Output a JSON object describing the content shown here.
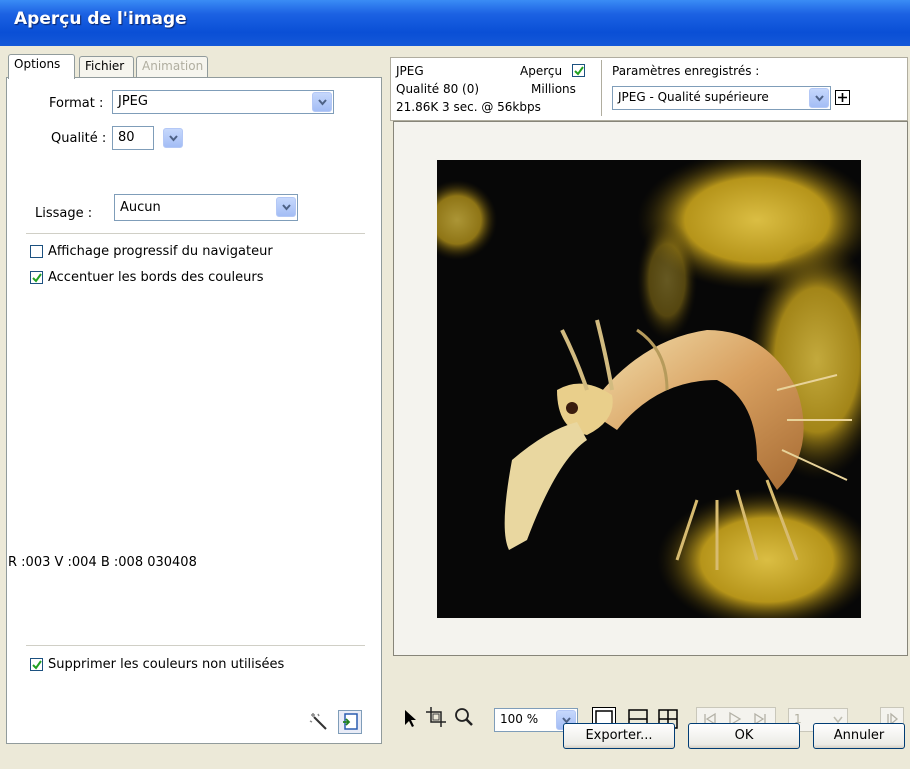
{
  "window": {
    "title": "Aperçu de l'image"
  },
  "tabs": [
    {
      "label": "Options"
    },
    {
      "label": "Fichier"
    },
    {
      "label": "Animation"
    }
  ],
  "options": {
    "format_label": "Format :",
    "format_value": "JPEG",
    "quality_label": "Qualité :",
    "quality_value": "80",
    "smoothing_label": "Lissage :",
    "smoothing_value": "Aucun",
    "progressive_label": "Affichage progressif du navigateur",
    "progressive_checked": false,
    "sharpen_label": "Accentuer les bords des couleurs",
    "sharpen_checked": true,
    "color_readout": "R :003 V :004 B :008 030408",
    "remove_unused_label": "Supprimer les couleurs non utilisées",
    "remove_unused_checked": true
  },
  "preview_info": {
    "format": "JPEG",
    "quality_line": "Qualité 80 (0)",
    "size_line": "21.86K  3 sec. @ 56kbps",
    "preview_label": "Aperçu",
    "preview_checked": true,
    "colors": "Millions",
    "saved_settings_label": "Paramètres enregistrés :",
    "saved_settings_value": "JPEG - Qualité supérieure"
  },
  "toolbar": {
    "zoom_value": "100 %",
    "frame_value": "1"
  },
  "buttons": {
    "export": "Exporter...",
    "ok": "OK",
    "cancel": "Annuler"
  },
  "icons": [
    "pointer-icon",
    "crop-icon",
    "zoom-icon",
    "magic-wand-icon",
    "export-wizard-icon",
    "single-view-icon",
    "two-up-icon",
    "four-up-icon",
    "first-frame-icon",
    "play-icon",
    "last-frame-icon",
    "next-frame-icon",
    "add-icon"
  ],
  "colors": {
    "title_bar": "#0a4fd6",
    "window_bg": "#ece9d8",
    "check": "#21a121"
  }
}
